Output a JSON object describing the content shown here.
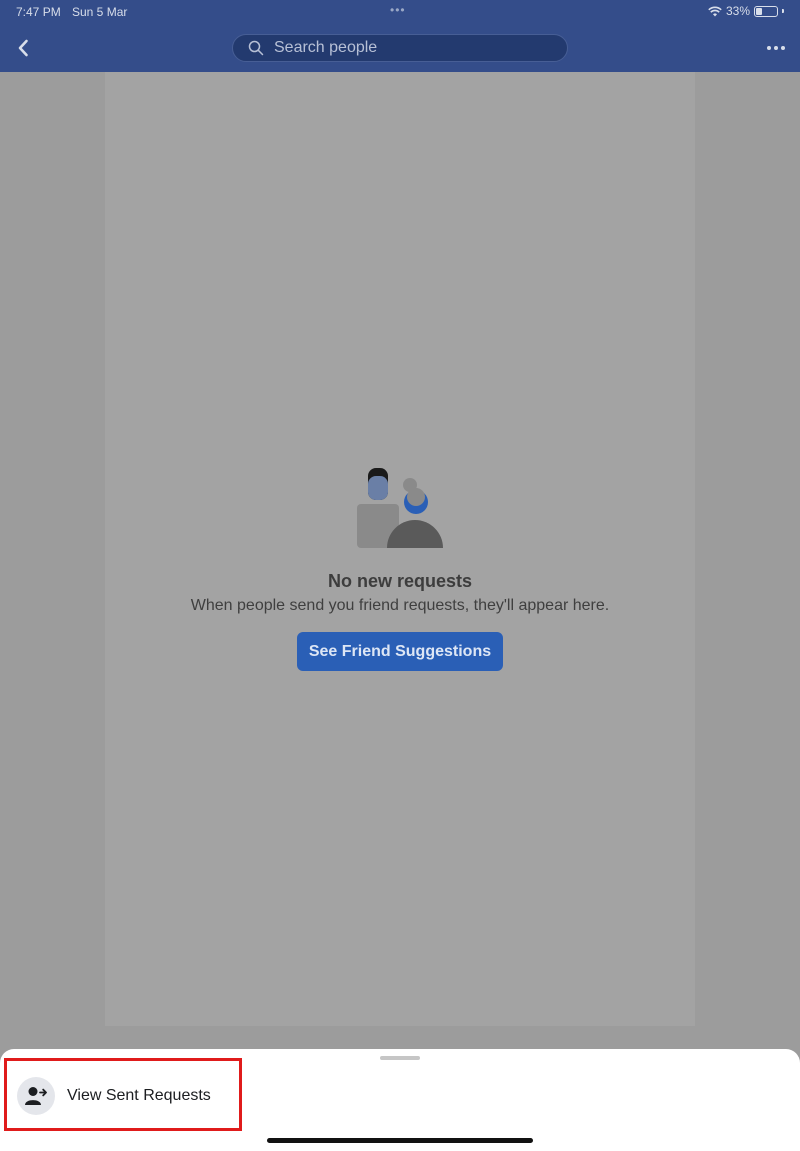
{
  "status_bar": {
    "time": "7:47 PM",
    "date": "Sun 5 Mar",
    "battery": "33%",
    "icons": [
      "wifi-icon",
      "battery-icon"
    ]
  },
  "header": {
    "back_icon": "chevron-left-icon",
    "search_placeholder": "Search people",
    "search_value": "",
    "more_icon": "more-horizontal-icon",
    "background_color": "#344d8a"
  },
  "empty_state": {
    "illustration": "friends-illustration",
    "title": "No new requests",
    "subtitle": "When people send you friend requests, they'll appear here.",
    "button_label": "See Friend Suggestions",
    "button_color": "#2a5fb6"
  },
  "bottom_sheet": {
    "item_icon": "person-add-icon",
    "item_label": "View Sent Requests",
    "highlight_color": "#e01b1b"
  }
}
